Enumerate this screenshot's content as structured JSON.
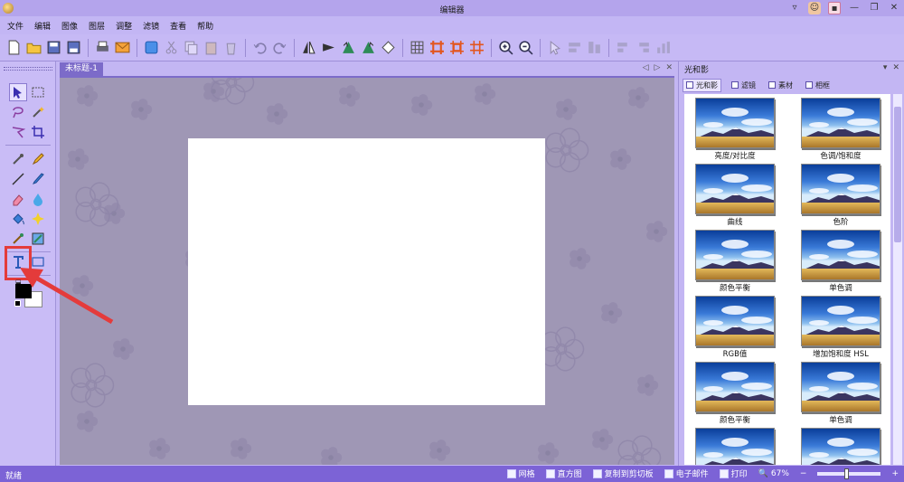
{
  "window": {
    "title": "编辑器"
  },
  "menu": [
    "文件",
    "编辑",
    "图像",
    "图层",
    "调整",
    "滤镜",
    "查看",
    "帮助"
  ],
  "toolbar": {
    "icons": [
      "new-file-icon",
      "open-folder-icon",
      "save-icon",
      "save-as-icon",
      "print-icon",
      "email-icon",
      "layer-icon",
      "cut-icon",
      "copy-icon",
      "paste-icon",
      "delete-icon",
      "undo-icon",
      "redo-icon",
      "flip-horizontal-icon",
      "flip-vertical-icon",
      "rotate-left-icon",
      "rotate-right-icon",
      "rotate-free-icon",
      "grid-icon",
      "frame-icon",
      "crop-frame-icon",
      "resize-icon",
      "zoom-in-icon",
      "zoom-out-icon",
      "pointer-icon",
      "align-icon",
      "distribute-icon",
      "align-left-icon",
      "align-right-icon",
      "chart-icon"
    ]
  },
  "document": {
    "tab": "未标题-1"
  },
  "right_panel": {
    "title": "光和影",
    "tabs": [
      "光和影",
      "滤镜",
      "素材",
      "相框"
    ],
    "effects": [
      "亮度/对比度",
      "色调/饱和度",
      "曲线",
      "色阶",
      "颜色平衡",
      "单色调",
      "RGB值",
      "增加饱和度 HSL",
      "颜色平衡",
      "单色调",
      "",
      ""
    ]
  },
  "colors": {
    "foreground": "#000000",
    "background": "#ffffff",
    "highlight": "#e43b3b"
  },
  "status": {
    "text": "就绪",
    "grid": "网格",
    "histogram": "直方图",
    "copy_clipboard": "复制到剪切板",
    "email": "电子邮件",
    "print": "打印",
    "zoom": "67%",
    "zoom_minus": "−",
    "zoom_plus": "+"
  }
}
